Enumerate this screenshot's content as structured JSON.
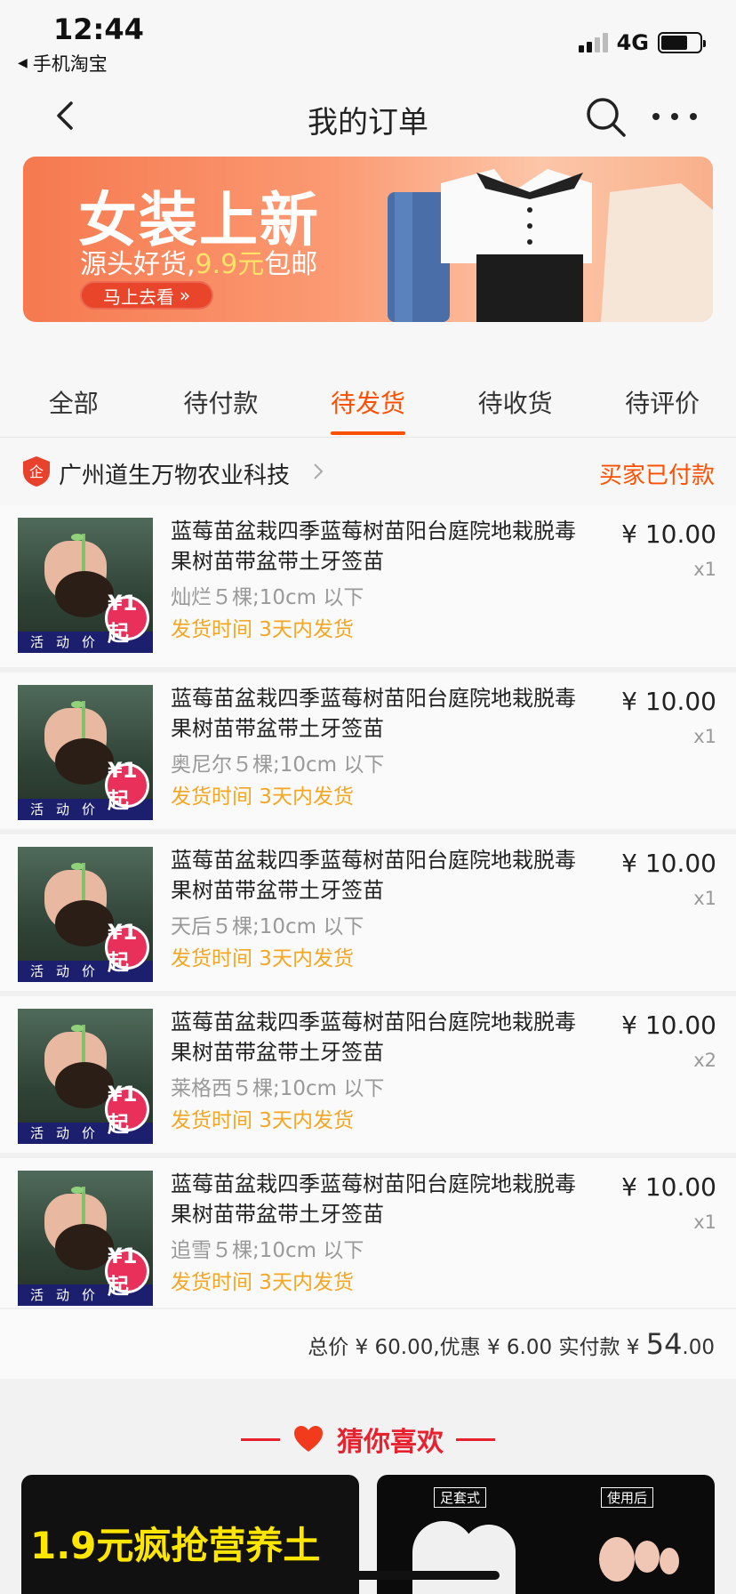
{
  "status_bar": {
    "time": "12:44",
    "back_app": "手机淘宝",
    "network": "4G"
  },
  "nav": {
    "title": "我的订单"
  },
  "banner": {
    "title": "女装上新",
    "sub_prefix": "源头好货,",
    "sub_highlight": "9.9元",
    "sub_suffix": "包邮",
    "button": "马上去看"
  },
  "tabs": [
    {
      "label": "全部"
    },
    {
      "label": "待付款"
    },
    {
      "label": "待发货"
    },
    {
      "label": "待收货"
    },
    {
      "label": "待评价"
    }
  ],
  "store": {
    "name": "广州道生万物农业科技",
    "status": "买家已付款"
  },
  "items": [
    {
      "title": "蓝莓苗盆栽四季蓝莓树苗阳台庭院地栽脱毒果树苗带盆带土牙签苗",
      "spec": "灿烂５棵;10cm 以下",
      "ship": "发货时间 3天内发货",
      "price": "¥ 10.00",
      "qty": "x1",
      "tag": "活动价",
      "badge": "¥1起"
    },
    {
      "title": "蓝莓苗盆栽四季蓝莓树苗阳台庭院地栽脱毒果树苗带盆带土牙签苗",
      "spec": "奥尼尔５棵;10cm 以下",
      "ship": "发货时间 3天内发货",
      "price": "¥ 10.00",
      "qty": "x1",
      "tag": "活动价",
      "badge": "¥1起"
    },
    {
      "title": "蓝莓苗盆栽四季蓝莓树苗阳台庭院地栽脱毒果树苗带盆带土牙签苗",
      "spec": "天后５棵;10cm 以下",
      "ship": "发货时间 3天内发货",
      "price": "¥ 10.00",
      "qty": "x1",
      "tag": "活动价",
      "badge": "¥1起"
    },
    {
      "title": "蓝莓苗盆栽四季蓝莓树苗阳台庭院地栽脱毒果树苗带盆带土牙签苗",
      "spec": "莱格西５棵;10cm 以下",
      "ship": "发货时间 3天内发货",
      "price": "¥ 10.00",
      "qty": "x2",
      "tag": "活动价",
      "badge": "¥1起"
    },
    {
      "title": "蓝莓苗盆栽四季蓝莓树苗阳台庭院地栽脱毒果树苗带盆带土牙签苗",
      "spec": "追雪５棵;10cm 以下",
      "ship": "发货时间 3天内发货",
      "price": "¥ 10.00",
      "qty": "x1",
      "tag": "活动价",
      "badge": "¥1起"
    }
  ],
  "total": {
    "prefix": "总价 ¥ 60.00,优惠 ¥ 6.00 实付款 ¥ ",
    "big": "54",
    "small": ".00"
  },
  "recommend": {
    "title": "猜你喜欢",
    "card1_promo": "1.9元疯抢营养土",
    "card2_label_left": "足套式",
    "card2_label_right": "使用后"
  },
  "colors": {
    "accent": "#ff5000",
    "ship": "#f5a623",
    "recommend": "#e7222e"
  }
}
